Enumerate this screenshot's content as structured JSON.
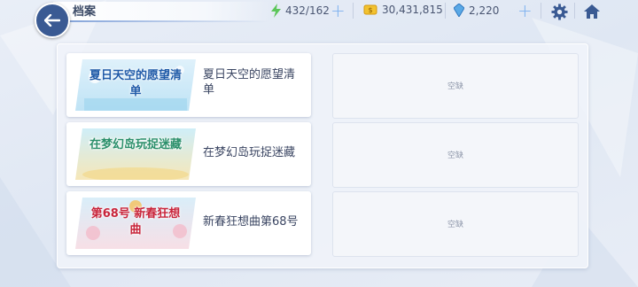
{
  "header": {
    "title": "档案"
  },
  "resources": {
    "stamina": {
      "value": "432/162",
      "icon": "lightning-icon",
      "color": "#5cc65a"
    },
    "mana": {
      "value": "30,431,815",
      "icon": "mana-icon",
      "color": "#f2c230"
    },
    "jewel": {
      "value": "2,220",
      "icon": "jewel-icon",
      "color": "#5aa9e6"
    }
  },
  "archives": [
    {
      "title": "夏日天空的愿望清单",
      "banner_text": "夏日天空的愿望清单"
    },
    {
      "title": "在梦幻岛玩捉迷藏",
      "banner_text": "在梦幻岛玩捉迷藏"
    },
    {
      "title": "新春狂想曲第68号",
      "banner_text": "第68号 新春狂想曲"
    }
  ],
  "slots": [
    {
      "label": "空缺"
    },
    {
      "label": "空缺"
    },
    {
      "label": "空缺"
    }
  ],
  "colors": {
    "accent": "#3a5a93",
    "plus": "#7cb0f0"
  }
}
